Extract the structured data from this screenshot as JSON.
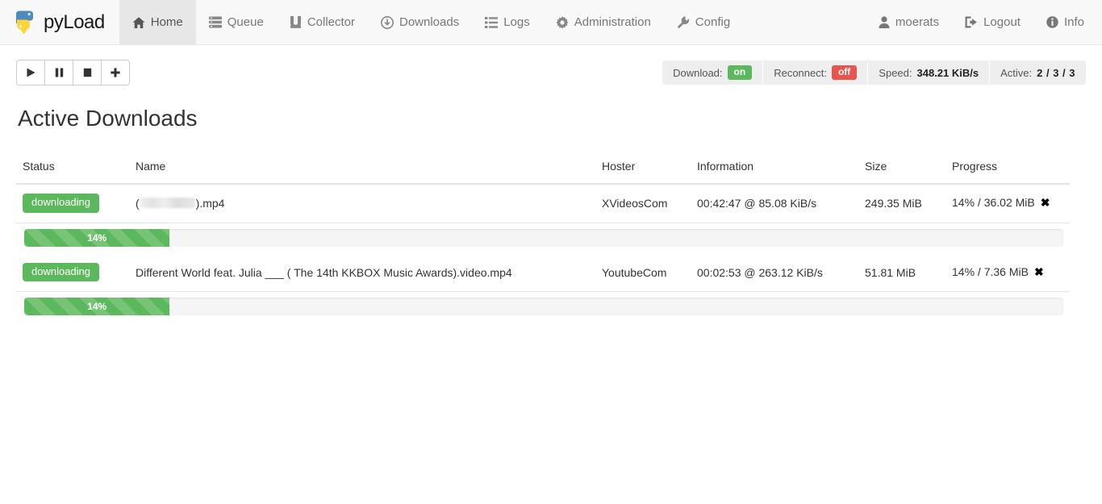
{
  "navbar": {
    "brand": {
      "text": "pyLoad",
      "icon": "pyload-logo"
    },
    "left_items": [
      {
        "label": "Home",
        "icon": "home-icon",
        "active": true
      },
      {
        "label": "Queue",
        "icon": "queue-icon",
        "active": false
      },
      {
        "label": "Collector",
        "icon": "magnet-icon",
        "active": false
      },
      {
        "label": "Downloads",
        "icon": "download-circle-icon",
        "active": false
      },
      {
        "label": "Logs",
        "icon": "list-icon",
        "active": false
      },
      {
        "label": "Administration",
        "icon": "gear-icon",
        "active": false
      },
      {
        "label": "Config",
        "icon": "wrench-icon",
        "active": false
      }
    ],
    "right_items": [
      {
        "label": "moerats",
        "icon": "user-icon"
      },
      {
        "label": "Logout",
        "icon": "logout-icon"
      },
      {
        "label": "Info",
        "icon": "info-icon"
      }
    ]
  },
  "toolbar": {
    "buttons": [
      {
        "name": "start",
        "icon": "play-icon"
      },
      {
        "name": "pause",
        "icon": "pause-icon"
      },
      {
        "name": "stop",
        "icon": "stop-icon"
      },
      {
        "name": "add",
        "icon": "plus-icon"
      }
    ]
  },
  "statusbar": {
    "download_label": "Download:",
    "download_state": "on",
    "reconnect_label": "Reconnect:",
    "reconnect_state": "off",
    "speed_label": "Speed:",
    "speed_value": "348.21 KiB/s",
    "active_label": "Active:",
    "active_value": "2 / 3 / 3",
    "colors": {
      "on": "#5cb85c",
      "off": "#e9544b",
      "background": "#eeeeee"
    }
  },
  "page": {
    "title": "Active Downloads"
  },
  "table": {
    "headers": [
      "Status",
      "Name",
      "Hoster",
      "Information",
      "Size",
      "Progress"
    ],
    "rows": [
      {
        "status": "downloading",
        "name_prefix": "(",
        "name_redacted": true,
        "name_suffix": ").mp4",
        "hoster": "XVideosCom",
        "information": "00:42:47 @ 85.08 KiB/s",
        "size": "249.35 MiB",
        "progress": "14% / 36.02 MiB",
        "progress_percent": 14,
        "progress_label": "14%",
        "close_icon": "close-icon"
      },
      {
        "status": "downloading",
        "name_prefix": "Different World feat. Julia ___ ( The 14th KKBOX Music Awards).video.mp4",
        "name_redacted": false,
        "name_suffix": "",
        "hoster": "YoutubeCom",
        "information": "00:02:53 @ 263.12 KiB/s",
        "size": "51.81 MiB",
        "progress": "14% / 7.36 MiB",
        "progress_percent": 14,
        "progress_label": "14%",
        "close_icon": "close-icon"
      }
    ]
  }
}
